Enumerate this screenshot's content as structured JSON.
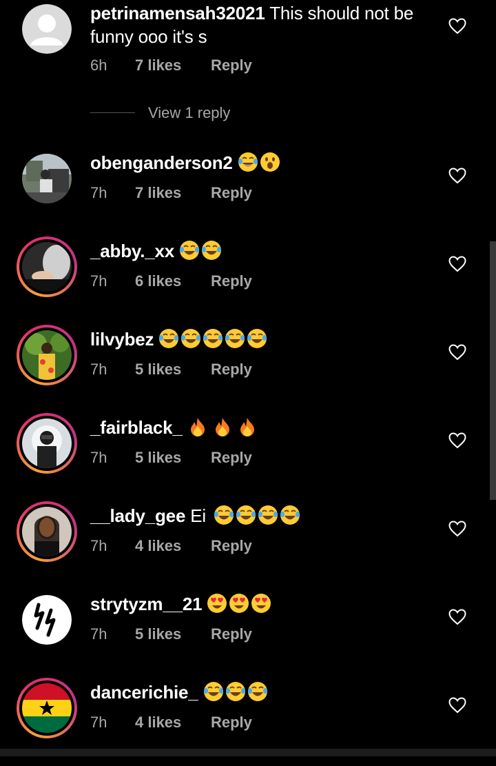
{
  "comments": [
    {
      "username": "petrinamensah32021",
      "text": "This should not be funny ooo it's s",
      "time": "6h",
      "likes": "7 likes",
      "reply": "Reply",
      "emojis": [],
      "avatar": "default"
    },
    {
      "username": "obenganderson2",
      "text": "",
      "time": "7h",
      "likes": "7 likes",
      "reply": "Reply",
      "emojis": [
        "tears-of-joy",
        "surprised"
      ],
      "avatar": "photo"
    },
    {
      "username": "_abby._xx",
      "text": "",
      "time": "7h",
      "likes": "6 likes",
      "reply": "Reply",
      "emojis": [
        "tears-of-joy",
        "tears-of-joy"
      ],
      "avatar": "photo-story"
    },
    {
      "username": "lilvybez",
      "text": "",
      "time": "7h",
      "likes": "5 likes",
      "reply": "Reply",
      "emojis": [
        "tears-of-joy",
        "tears-of-joy",
        "tears-of-joy",
        "tears-of-joy",
        "tears-of-joy"
      ],
      "avatar": "photo-story"
    },
    {
      "username": "_fairblack_",
      "text": "",
      "time": "7h",
      "likes": "5 likes",
      "reply": "Reply",
      "emojis": [
        "fire",
        "fire",
        "fire"
      ],
      "avatar": "photo-story"
    },
    {
      "username": "__lady_gee",
      "text": "Ei",
      "time": "7h",
      "likes": "4 likes",
      "reply": "Reply",
      "emojis": [
        "tears-of-joy",
        "tears-of-joy",
        "tears-of-joy",
        "tears-of-joy"
      ],
      "avatar": "photo-story"
    },
    {
      "username": "strytyzm__21",
      "text": "",
      "time": "7h",
      "likes": "5 likes",
      "reply": "Reply",
      "emojis": [
        "heart-eyes",
        "heart-eyes",
        "heart-eyes"
      ],
      "avatar": "logo"
    },
    {
      "username": "dancerichie_",
      "text": "",
      "time": "7h",
      "likes": "4 likes",
      "reply": "Reply",
      "emojis": [
        "tears-of-joy",
        "tears-of-joy",
        "tears-of-joy"
      ],
      "avatar": "ghana-flag-story"
    }
  ],
  "view_replies": "View 1 reply",
  "colors": {
    "background": "#000000",
    "meta_text": "#a8a8a8",
    "story_ring_start": "#f9a13a",
    "story_ring_end": "#c13584",
    "ghana_red": "#ce1126",
    "ghana_gold": "#fcd116",
    "ghana_green": "#006b3f"
  }
}
